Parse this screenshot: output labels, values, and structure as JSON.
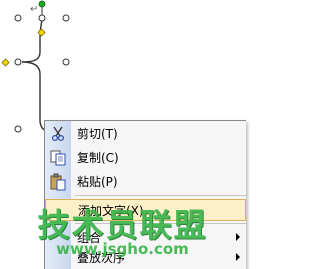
{
  "canvas": {
    "pilcrow": "↵"
  },
  "menu": {
    "items": [
      {
        "label": "剪切(T)",
        "icon": "scissors-icon"
      },
      {
        "label": "复制(C)",
        "icon": "copy-icon"
      },
      {
        "label": "粘贴(P)",
        "icon": "paste-icon"
      },
      {
        "label": "添加文字(X)",
        "icon": "none"
      },
      {
        "label": "组合",
        "icon": "none",
        "submenu": true
      },
      {
        "label": "叠放次序",
        "icon": "none",
        "submenu": true
      }
    ]
  },
  "watermark": {
    "title": "技术员联盟",
    "url": "www.jsgho.com"
  },
  "colors": {
    "handle_green": "#22aa22",
    "handle_yellow": "#f2d800",
    "highlight": "#fcf0c8",
    "watermark": "#3ab54a"
  }
}
